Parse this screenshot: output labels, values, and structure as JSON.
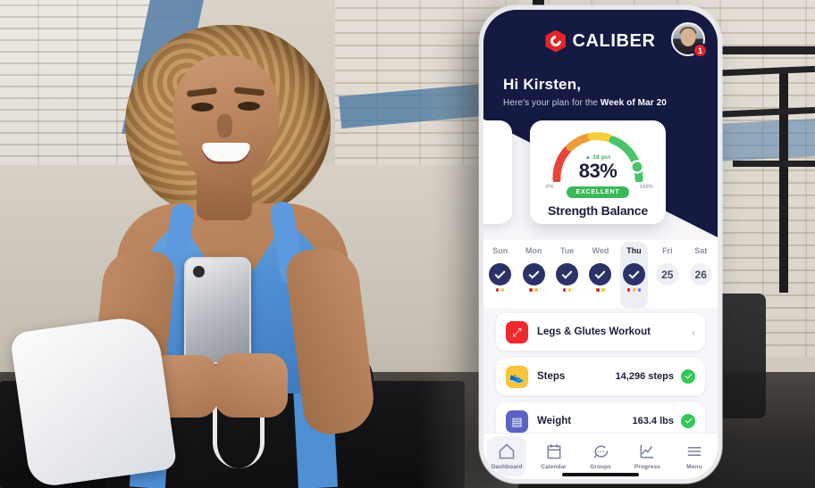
{
  "scene": {
    "description": "Woman in blue athletic wear sitting on a gym bench holding a smartphone",
    "setting": "gym-interior"
  },
  "phone": {
    "header": {
      "logo_mark": "caliber-hexagon-icon",
      "logo_text": "CALIBER",
      "avatar_name": "user-avatar",
      "notification_count": "1",
      "greeting_title": "Hi Kirsten,",
      "greeting_sub_prefix": "Here's your plan for the ",
      "greeting_sub_bold": "Week of Mar 20"
    },
    "gauge_card": {
      "delta": "▲ 18 pct",
      "percent": "83%",
      "min_label": "0%",
      "max_label": "100%",
      "status_badge": "EXCELLENT",
      "title": "Strength Balance",
      "colors": {
        "red": "#e8443a",
        "orange": "#f09a36",
        "yellow": "#f7cf3c",
        "green": "#4cc368",
        "badge": "#3cb85a"
      }
    },
    "week": {
      "days": [
        {
          "name": "Sun",
          "state": "done",
          "value": "",
          "dots": [
            "red",
            "yellow"
          ],
          "active": false
        },
        {
          "name": "Mon",
          "state": "done",
          "value": "",
          "dots": [
            "red",
            "yellow"
          ],
          "active": false
        },
        {
          "name": "Tue",
          "state": "done",
          "value": "",
          "dots": [
            "red",
            "yellow"
          ],
          "active": false
        },
        {
          "name": "Wed",
          "state": "done",
          "value": "",
          "dots": [
            "red",
            "yellow"
          ],
          "active": false
        },
        {
          "name": "Thu",
          "state": "done",
          "value": "",
          "dots": [
            "red",
            "yellow",
            "blue"
          ],
          "active": true
        },
        {
          "name": "Fri",
          "state": "num",
          "value": "25",
          "dots": [],
          "active": false
        },
        {
          "name": "Sat",
          "state": "num",
          "value": "26",
          "dots": [],
          "active": false
        }
      ]
    },
    "rows": [
      {
        "icon": "workout-arrows-icon",
        "glyph": "⤢",
        "title": "Legs & Glutes Workout",
        "value": "",
        "trailing": "chevron",
        "color": "#ee2a2f"
      },
      {
        "icon": "steps-shoe-icon",
        "glyph": "👟",
        "title": "Steps",
        "value": "14,296 steps",
        "trailing": "check",
        "color": "#f8c43a"
      },
      {
        "icon": "weight-scale-icon",
        "glyph": "▤",
        "title": "Weight",
        "value": "163.4 lbs",
        "trailing": "check",
        "color": "#5b62c4"
      }
    ],
    "tabs": [
      {
        "icon": "home-icon",
        "label": "Dashboard",
        "active": true
      },
      {
        "icon": "calendar-icon",
        "label": "Calendar",
        "active": false
      },
      {
        "icon": "chat-icon",
        "label": "Groups",
        "active": false
      },
      {
        "icon": "chart-icon",
        "label": "Progress",
        "active": false
      },
      {
        "icon": "menu-icon",
        "label": "Menu",
        "active": false
      }
    ]
  }
}
